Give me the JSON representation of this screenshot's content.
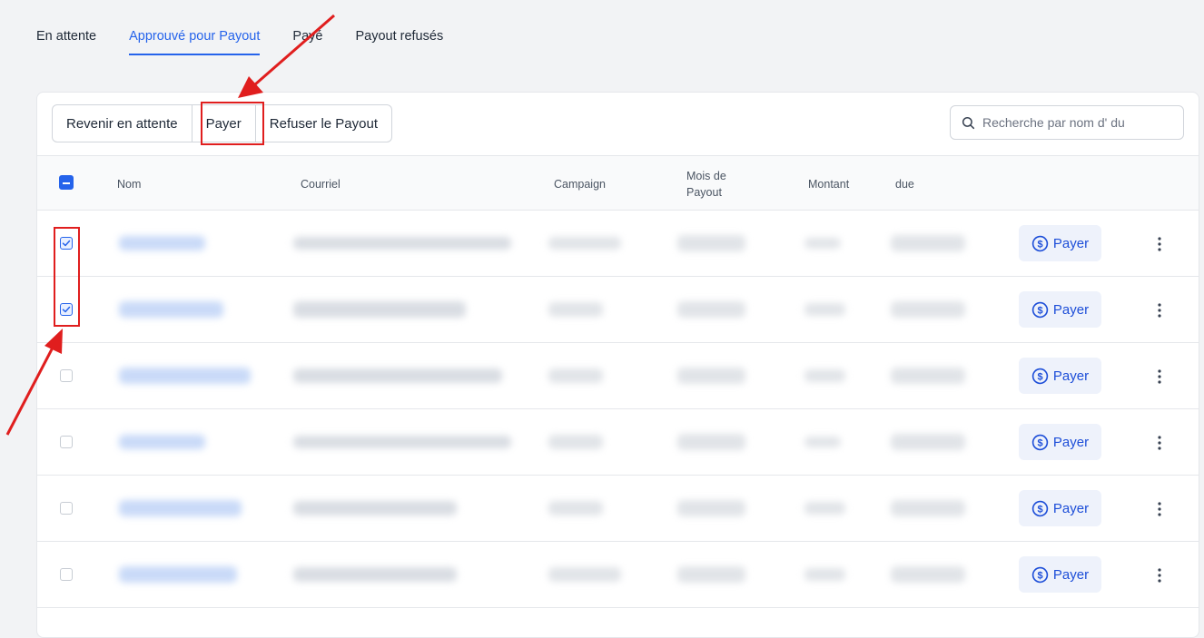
{
  "tabs": [
    {
      "label": "En attente",
      "active": false
    },
    {
      "label": "Approuvé pour Payout",
      "active": true
    },
    {
      "label": "Payé",
      "active": false
    },
    {
      "label": "Payout refusés",
      "active": false
    }
  ],
  "toolbar": {
    "revert_label": "Revenir en attente",
    "pay_label": "Payer",
    "refuse_label": "Refuser le Payout"
  },
  "search": {
    "placeholder": "Recherche par nom d' du"
  },
  "table": {
    "headers": {
      "name": "Nom",
      "email": "Courriel",
      "campaign": "Campaign",
      "month": "Mois de Payout",
      "amount": "Montant",
      "due": "due"
    },
    "rows": [
      {
        "checked": true,
        "pay_label": "Payer"
      },
      {
        "checked": true,
        "pay_label": "Payer"
      },
      {
        "checked": false,
        "pay_label": "Payer"
      },
      {
        "checked": false,
        "pay_label": "Payer"
      },
      {
        "checked": false,
        "pay_label": "Payer"
      },
      {
        "checked": false,
        "pay_label": "Payer"
      }
    ]
  },
  "colors": {
    "accent": "#2563eb",
    "annotation": "#e01e1e"
  },
  "icons": {
    "search": "search-icon",
    "pay": "dollar-circle-icon",
    "more": "kebab-menu-icon"
  }
}
